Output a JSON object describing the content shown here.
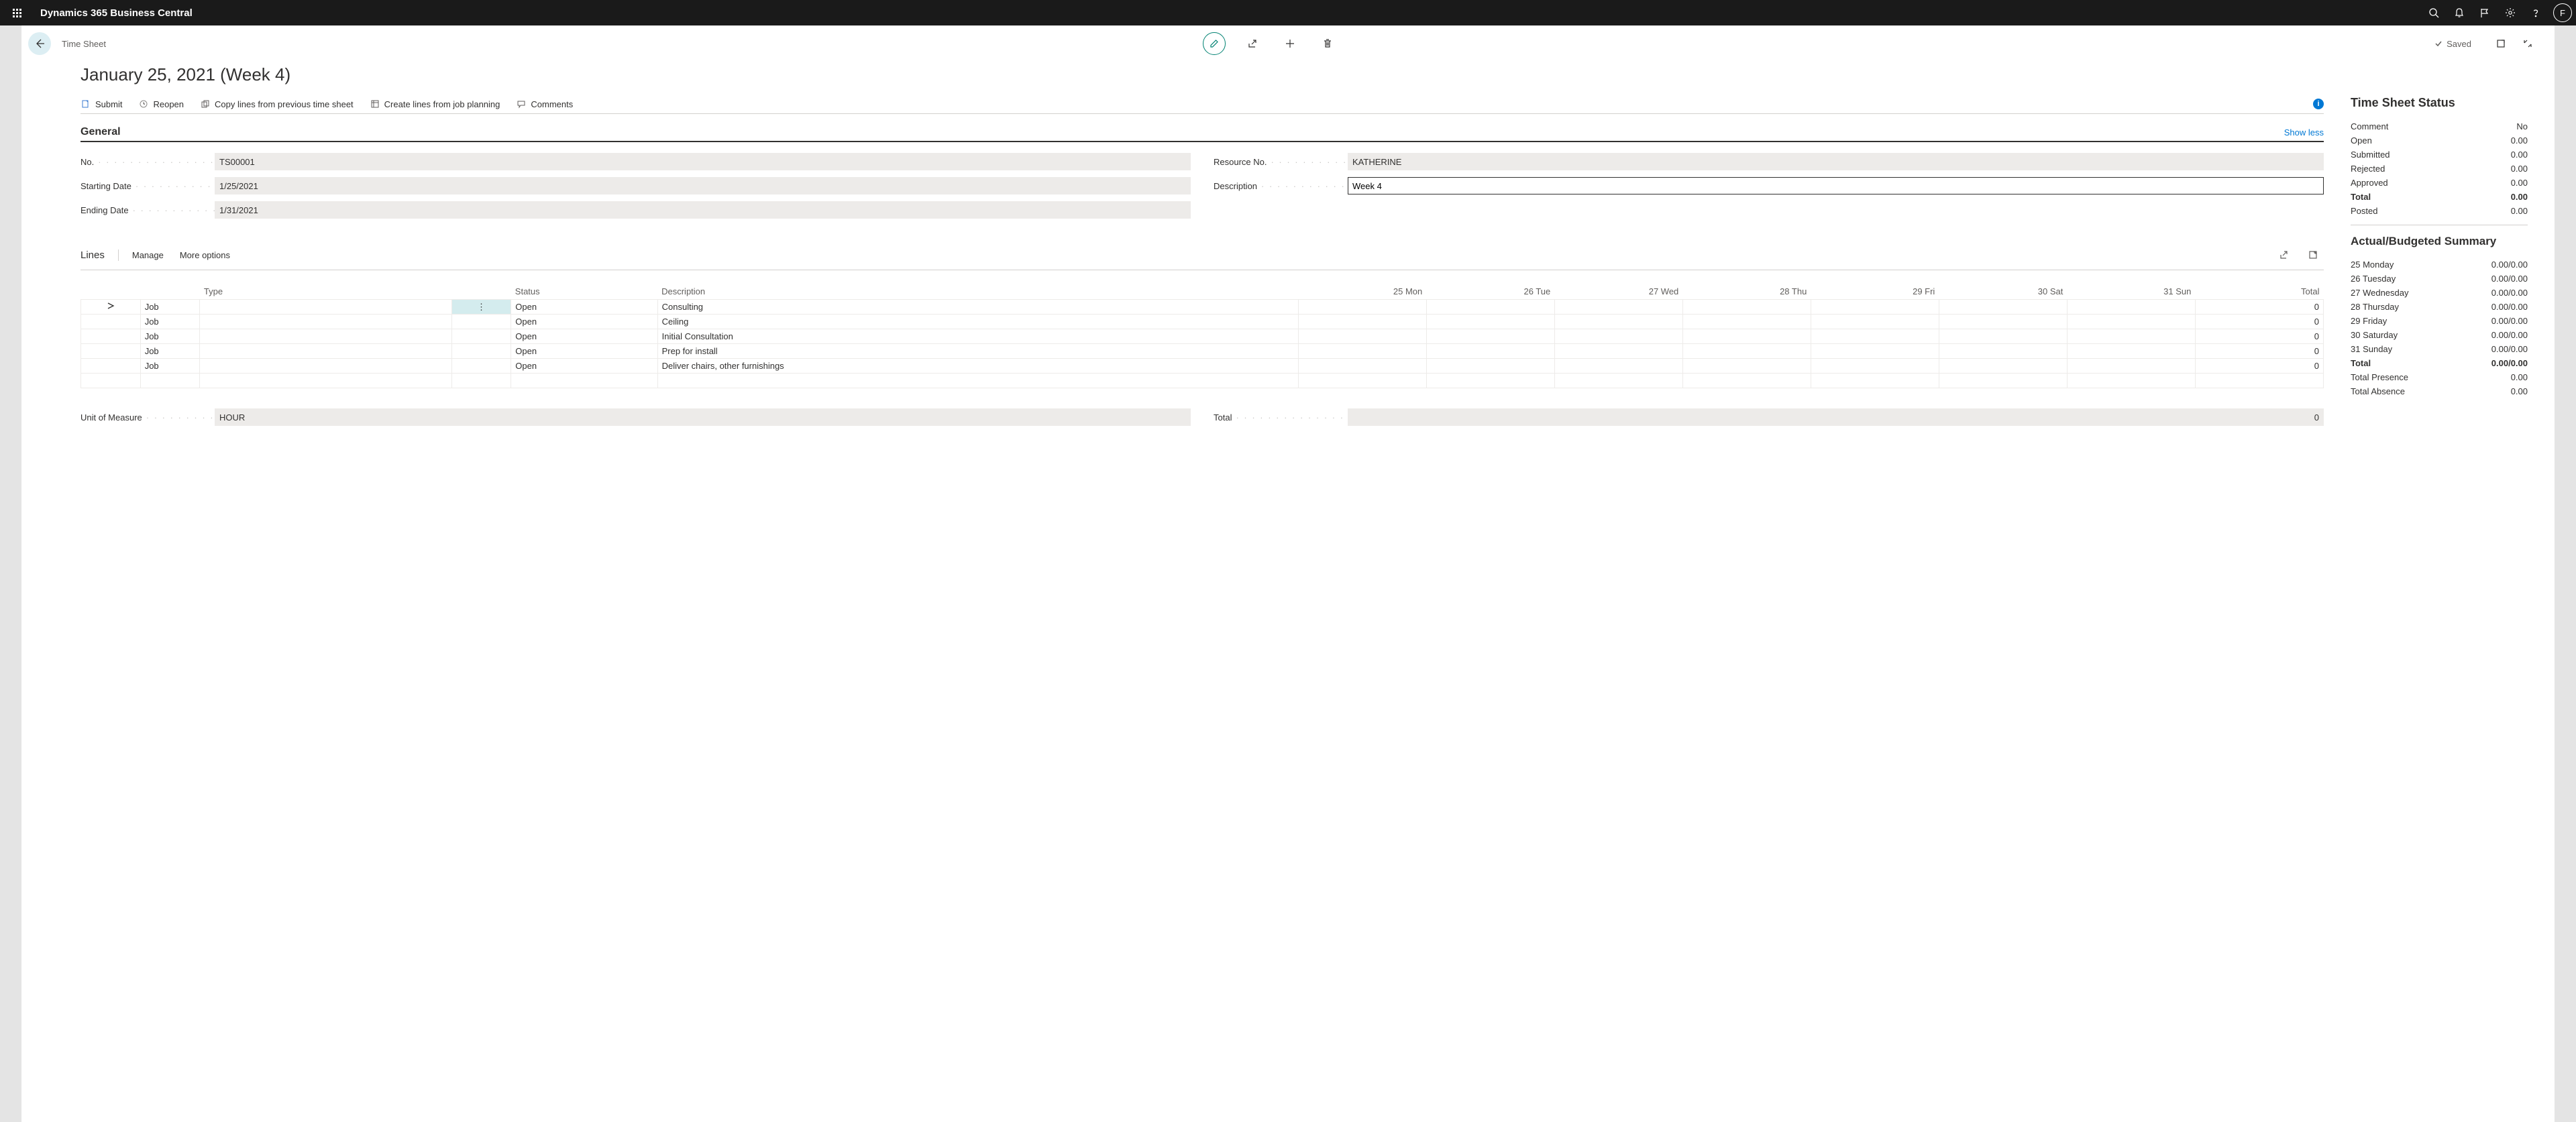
{
  "header": {
    "app_title": "Dynamics 365 Business Central",
    "avatar_letter": "F"
  },
  "card": {
    "breadcrumb": "Time Sheet",
    "saved_label": "Saved",
    "title": "January 25, 2021 (Week 4)"
  },
  "actions": {
    "submit": "Submit",
    "reopen": "Reopen",
    "copy": "Copy lines from previous time sheet",
    "create": "Create lines from job planning",
    "comments": "Comments",
    "info": "i"
  },
  "general": {
    "title": "General",
    "show_less": "Show less",
    "no_label": "No.",
    "no_value": "TS00001",
    "starting_label": "Starting Date",
    "starting_value": "1/25/2021",
    "ending_label": "Ending Date",
    "ending_value": "1/31/2021",
    "resource_label": "Resource No.",
    "resource_value": "KATHERINE",
    "description_label": "Description",
    "description_value": "Week 4"
  },
  "lines": {
    "title": "Lines",
    "manage": "Manage",
    "more": "More options",
    "headers": {
      "type": "Type",
      "status": "Status",
      "description": "Description",
      "d1": "25 Mon",
      "d2": "26 Tue",
      "d3": "27 Wed",
      "d4": "28 Thu",
      "d5": "29 Fri",
      "d6": "30 Sat",
      "d7": "31 Sun",
      "total": "Total"
    },
    "rows": [
      {
        "type": "Job",
        "status": "Open",
        "desc": "Consulting",
        "total": "0"
      },
      {
        "type": "Job",
        "status": "Open",
        "desc": "Ceiling",
        "total": "0"
      },
      {
        "type": "Job",
        "status": "Open",
        "desc": "Initial Consultation",
        "total": "0"
      },
      {
        "type": "Job",
        "status": "Open",
        "desc": "Prep for install",
        "total": "0"
      },
      {
        "type": "Job",
        "status": "Open",
        "desc": "Deliver chairs, other furnishings",
        "total": "0"
      }
    ],
    "uom_label": "Unit of Measure",
    "uom_value": "HOUR",
    "total_label": "Total",
    "total_value": "0"
  },
  "status_box": {
    "title": "Time Sheet Status",
    "rows": [
      {
        "label": "Comment",
        "value": "No"
      },
      {
        "label": "Open",
        "value": "0.00"
      },
      {
        "label": "Submitted",
        "value": "0.00"
      },
      {
        "label": "Rejected",
        "value": "0.00"
      },
      {
        "label": "Approved",
        "value": "0.00"
      },
      {
        "label": "Total",
        "value": "0.00",
        "bold": true
      },
      {
        "label": "Posted",
        "value": "0.00"
      }
    ]
  },
  "summary_box": {
    "title": "Actual/Budgeted Summary",
    "rows": [
      {
        "label": "25 Monday",
        "value": "0.00/0.00"
      },
      {
        "label": "26 Tuesday",
        "value": "0.00/0.00"
      },
      {
        "label": "27 Wednesday",
        "value": "0.00/0.00"
      },
      {
        "label": "28 Thursday",
        "value": "0.00/0.00"
      },
      {
        "label": "29 Friday",
        "value": "0.00/0.00"
      },
      {
        "label": "30 Saturday",
        "value": "0.00/0.00"
      },
      {
        "label": "31 Sunday",
        "value": "0.00/0.00"
      },
      {
        "label": "Total",
        "value": "0.00/0.00",
        "bold": true
      },
      {
        "label": "Total Presence",
        "value": "0.00"
      },
      {
        "label": "Total Absence",
        "value": "0.00"
      }
    ]
  }
}
